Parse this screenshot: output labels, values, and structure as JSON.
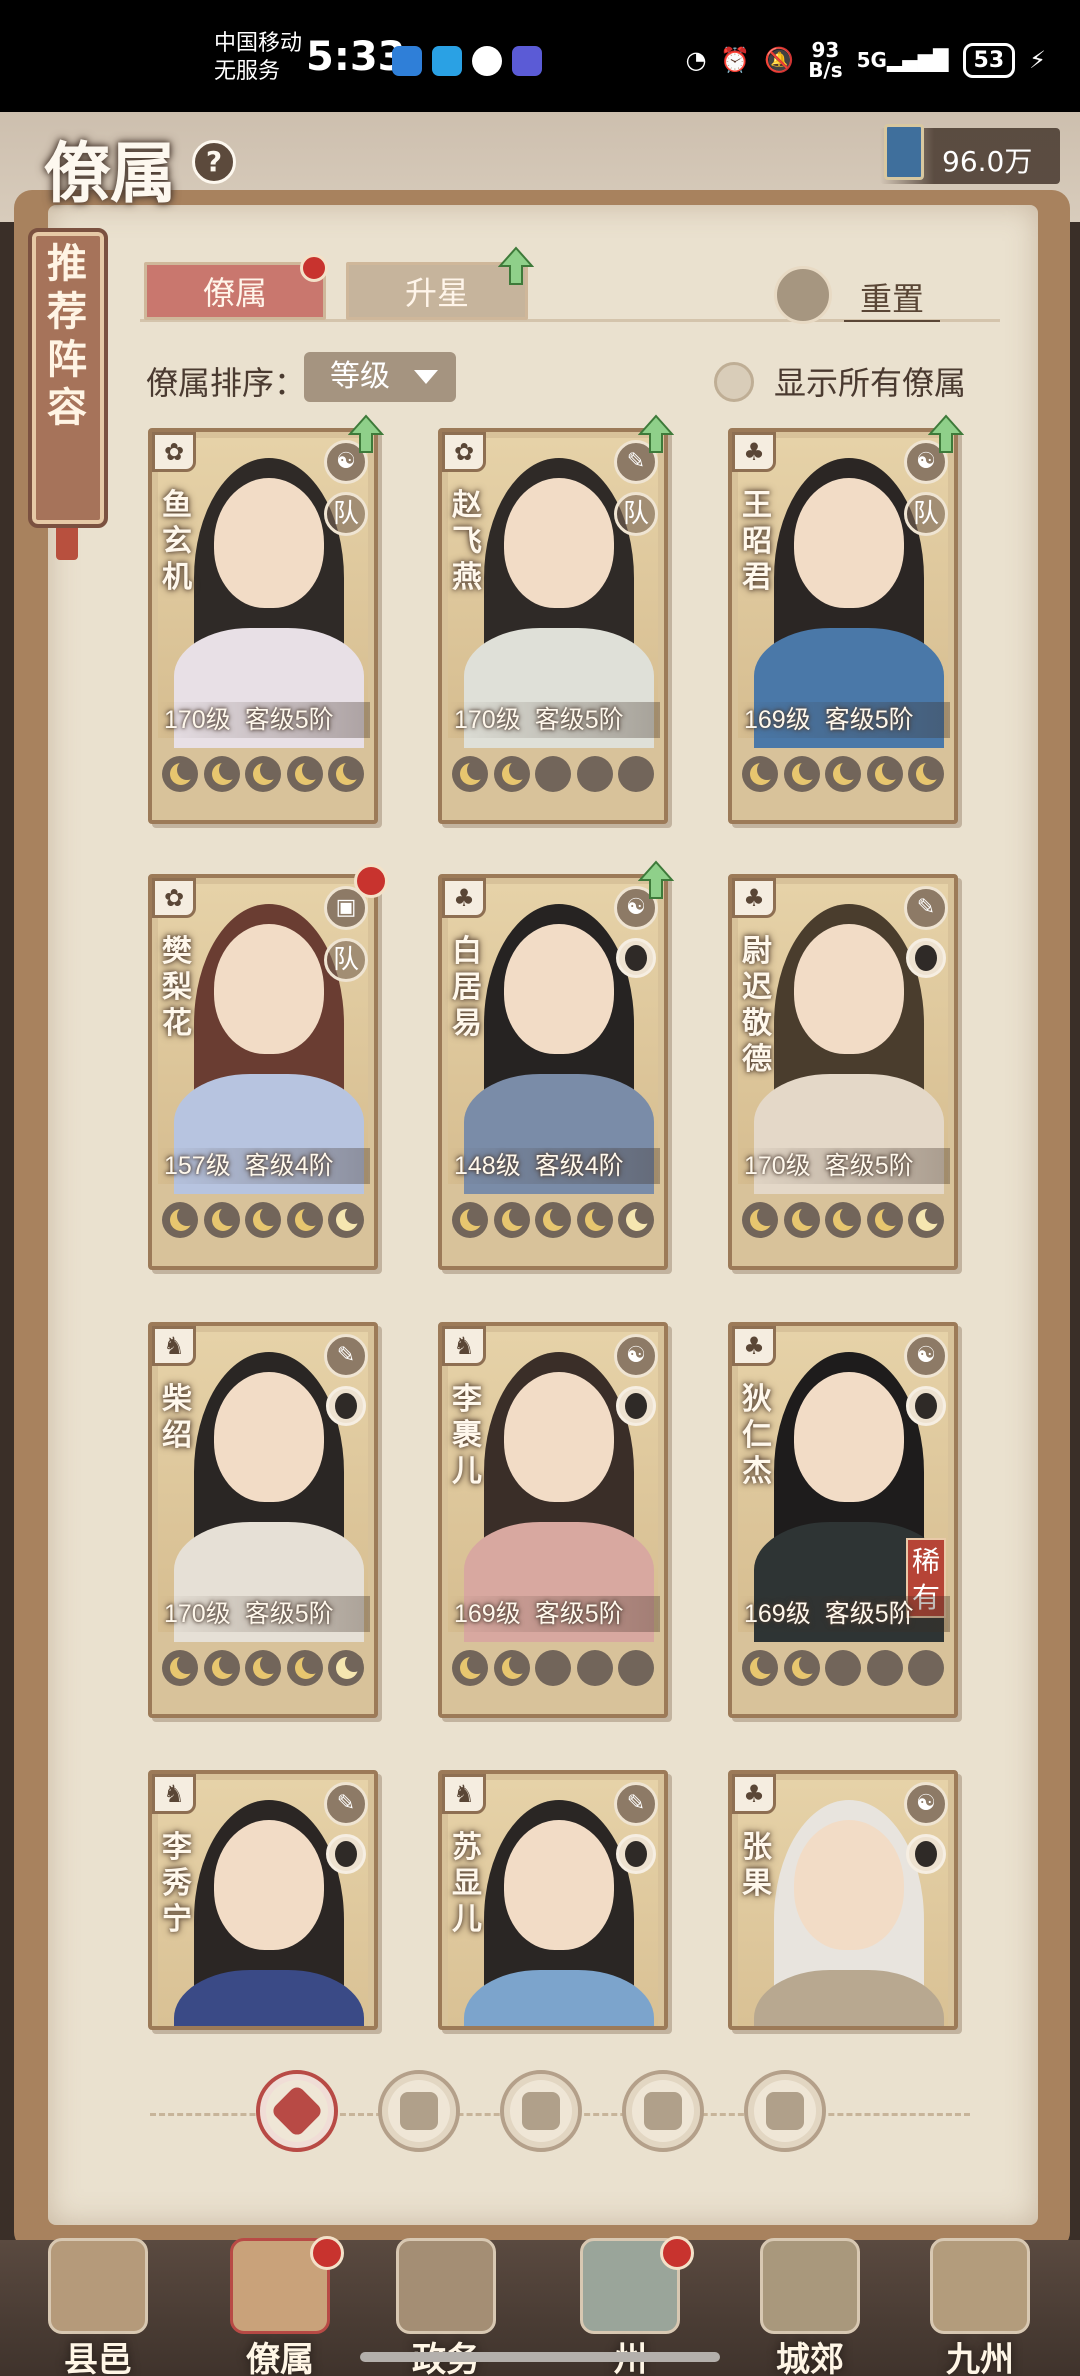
{
  "status_bar": {
    "carrier_line1": "中国移动",
    "carrier_line2": "无服务",
    "time": "5:33",
    "net_speed_value": "93",
    "net_speed_unit": "B/s",
    "network": "5G",
    "battery": "53"
  },
  "header": {
    "title": "僚属",
    "help": "?",
    "currency_value": "96.0万"
  },
  "bookmark": {
    "label": "推荐阵容"
  },
  "tabs": [
    {
      "label": "僚属",
      "active": true
    },
    {
      "label": "升星",
      "active": false
    }
  ],
  "reset_label": "重置",
  "sort": {
    "label": "僚属排序：",
    "selected": "等级"
  },
  "show_all_label": "显示所有僚属",
  "cards": [
    {
      "name": "鱼玄机",
      "level": "170级",
      "rank": "客级5阶",
      "moons": 5,
      "team": "队",
      "up": true,
      "reddot": false,
      "rare": ""
    },
    {
      "name": "赵飞燕",
      "level": "170级",
      "rank": "客级5阶",
      "moons": 2,
      "team": "队",
      "up": true,
      "reddot": false,
      "rare": ""
    },
    {
      "name": "王昭君",
      "level": "169级",
      "rank": "客级5阶",
      "moons": 5,
      "team": "队",
      "up": true,
      "reddot": false,
      "rare": ""
    },
    {
      "name": "樊梨花",
      "level": "157级",
      "rank": "客级4阶",
      "moons": 5,
      "team": "队",
      "up": false,
      "reddot": true,
      "rare": ""
    },
    {
      "name": "白居易",
      "level": "148级",
      "rank": "客级4阶",
      "moons": 5,
      "team": "",
      "up": true,
      "reddot": false,
      "rare": ""
    },
    {
      "name": "尉迟敬德",
      "level": "170级",
      "rank": "客级5阶",
      "moons": 5,
      "team": "",
      "up": false,
      "reddot": false,
      "rare": ""
    },
    {
      "name": "柴绍",
      "level": "170级",
      "rank": "客级5阶",
      "moons": 5,
      "team": "",
      "up": false,
      "reddot": false,
      "rare": ""
    },
    {
      "name": "李裹儿",
      "level": "169级",
      "rank": "客级5阶",
      "moons": 2,
      "team": "",
      "up": false,
      "reddot": false,
      "rare": ""
    },
    {
      "name": "狄仁杰",
      "level": "169级",
      "rank": "客级5阶",
      "moons": 2,
      "team": "",
      "up": false,
      "reddot": false,
      "rare": "稀有"
    },
    {
      "name": "李秀宁",
      "level": "",
      "rank": "",
      "moons": 0,
      "team": "",
      "up": false,
      "reddot": false,
      "rare": ""
    },
    {
      "name": "苏显儿",
      "level": "",
      "rank": "",
      "moons": 0,
      "team": "",
      "up": false,
      "reddot": false,
      "rare": ""
    },
    {
      "name": "张果",
      "level": "",
      "rank": "",
      "moons": 0,
      "team": "",
      "up": false,
      "reddot": false,
      "rare": ""
    }
  ],
  "bottom_nav": [
    {
      "label": "县邑"
    },
    {
      "label": "僚属",
      "active": true,
      "reddot": true
    },
    {
      "label": "政务"
    },
    {
      "label": "州",
      "reddot": true
    },
    {
      "label": "城郊"
    },
    {
      "label": "九州"
    }
  ],
  "colors": {
    "accent_red": "#c8332e",
    "tab_active": "#c9776e",
    "paper": "#eae1cf",
    "green_arrow": "#8fd08a"
  }
}
